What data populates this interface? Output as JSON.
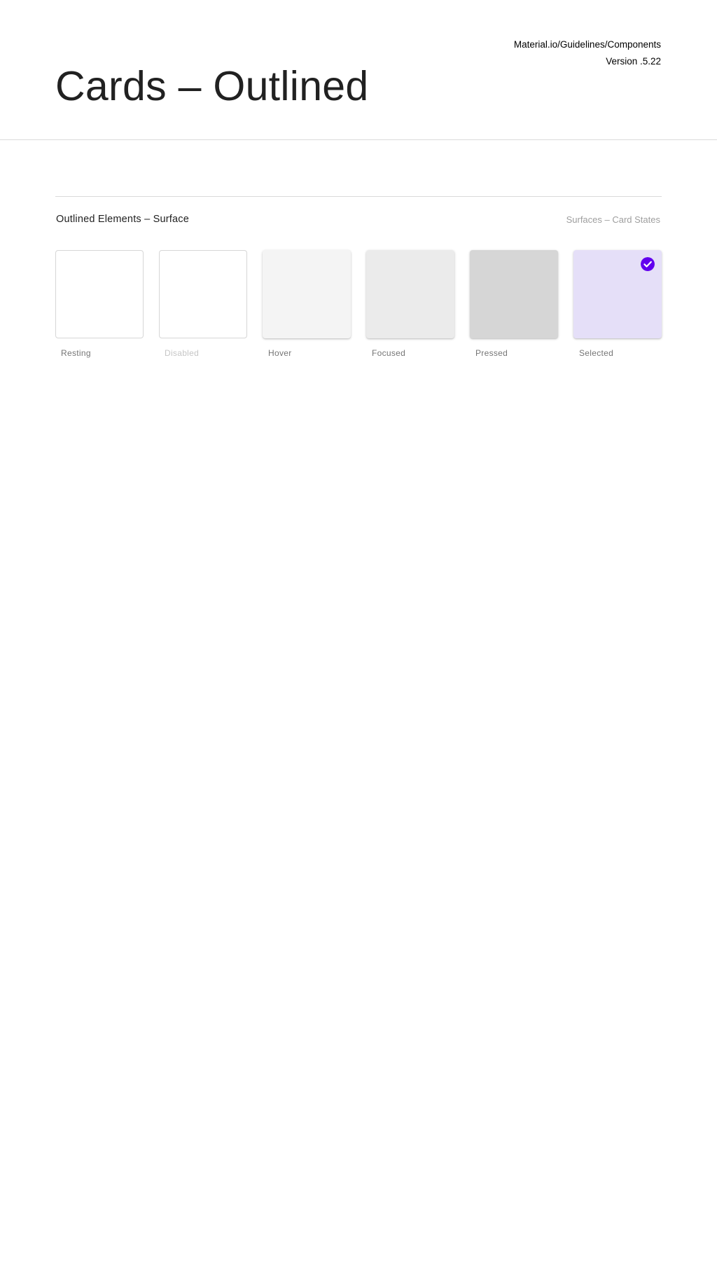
{
  "header": {
    "title": "Cards – Outlined",
    "source": "Material.io/Guidelines/Components",
    "version": "Version .5.22"
  },
  "section": {
    "title": "Outlined Elements – Surface",
    "subtitle": "Surfaces – Card States"
  },
  "states": [
    {
      "label": "Resting",
      "fill": "#ffffff",
      "border": "#d6d6d6"
    },
    {
      "label": "Disabled",
      "fill": "#ffffff",
      "border": "#d6d6d6"
    },
    {
      "label": "Hover",
      "fill": "#f4f4f4"
    },
    {
      "label": "Focused",
      "fill": "#ebebeb"
    },
    {
      "label": "Pressed",
      "fill": "#d6d6d6"
    },
    {
      "label": "Selected",
      "fill": "#e5dff8",
      "icon": "check-circle-icon",
      "icon_color": "#6200ee"
    }
  ],
  "colors": {
    "title_text": "#212121",
    "meta_text": "#000000",
    "label_text": "#757575",
    "disabled_label_text": "#c6c6c6",
    "divider": "#dadada",
    "accent": "#6200ee"
  }
}
